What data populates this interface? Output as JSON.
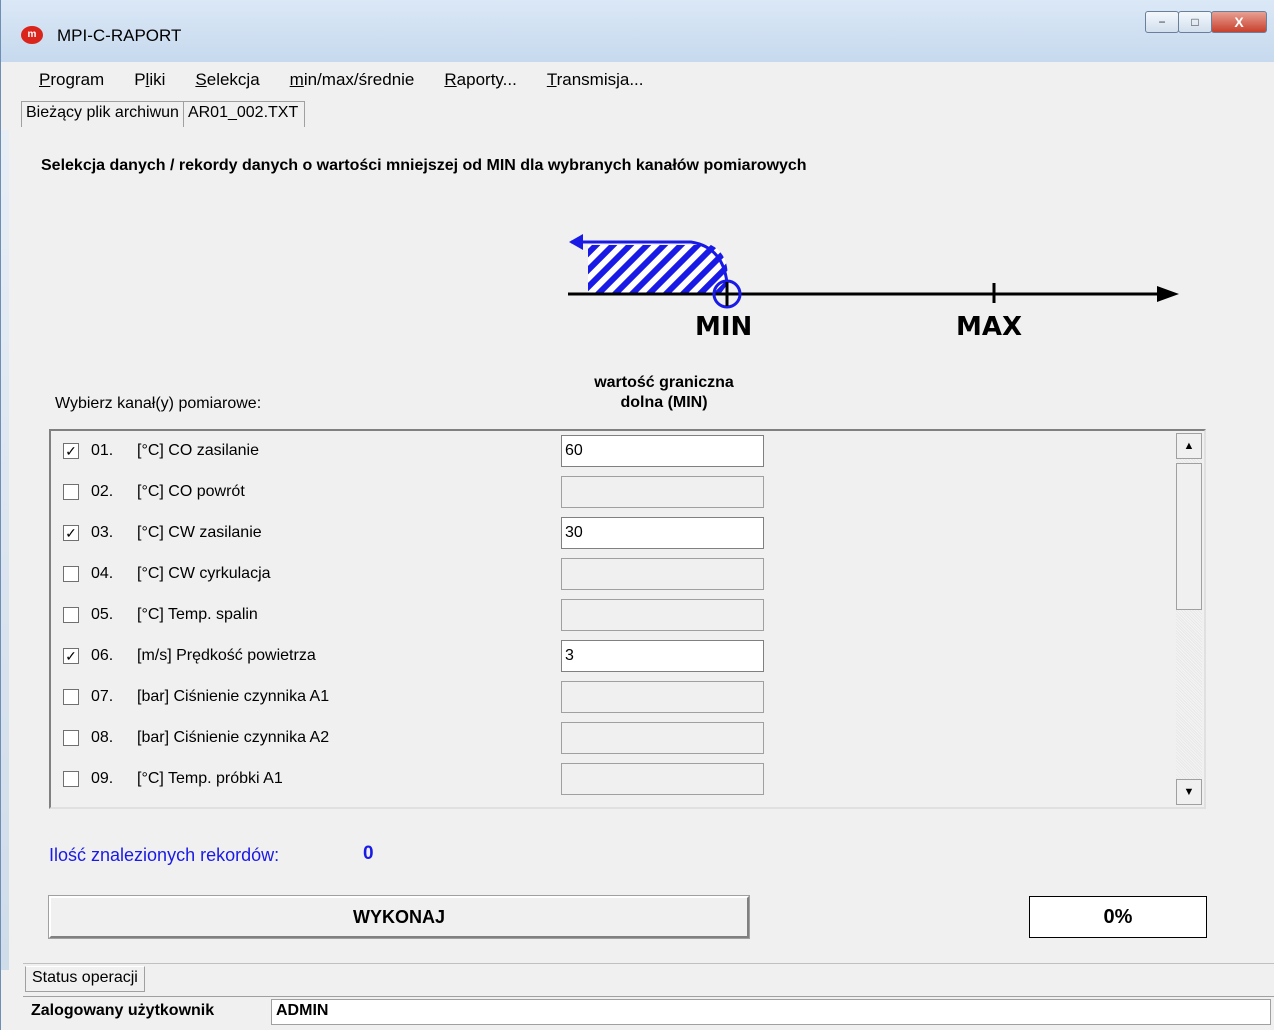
{
  "window": {
    "title": "MPI-C-RAPORT",
    "logo": "m",
    "minimize": "−",
    "maximize": "□",
    "close": "X"
  },
  "menu": [
    {
      "pre": "",
      "u": "P",
      "post": "rogram"
    },
    {
      "pre": "P",
      "u": "l",
      "post": "iki"
    },
    {
      "pre": "",
      "u": "S",
      "post": "elekcja"
    },
    {
      "pre": "",
      "u": "m",
      "post": "in/max/średnie"
    },
    {
      "pre": "",
      "u": "R",
      "post": "aporty..."
    },
    {
      "pre": "",
      "u": "T",
      "post": "ransmisja..."
    }
  ],
  "file": {
    "label": "Bieżący plik archiwun",
    "value": "AR01_002.TXT"
  },
  "header": "Selekcja danych / rekordy danych o wartości mniejszej od MIN dla wybranych kanałów pomiarowych",
  "diagram": {
    "min": "MIN",
    "max": "MAX"
  },
  "channel_label": "Wybierz kanał(y) pomiarowe:",
  "column_header_line1": "wartość graniczna",
  "column_header_line2": "dolna (MIN)",
  "rows": [
    {
      "num": "01.",
      "name": "[°C] CO zasilanie",
      "checked": true,
      "value": "60"
    },
    {
      "num": "02.",
      "name": "[°C] CO powrót",
      "checked": false,
      "value": ""
    },
    {
      "num": "03.",
      "name": "[°C] CW zasilanie",
      "checked": true,
      "value": "30"
    },
    {
      "num": "04.",
      "name": "[°C] CW cyrkulacja",
      "checked": false,
      "value": ""
    },
    {
      "num": "05.",
      "name": "[°C] Temp. spalin",
      "checked": false,
      "value": ""
    },
    {
      "num": "06.",
      "name": "[m/s] Prędkość powietrza",
      "checked": true,
      "value": "3"
    },
    {
      "num": "07.",
      "name": "[bar] Ciśnienie czynnika A1",
      "checked": false,
      "value": ""
    },
    {
      "num": "08.",
      "name": "[bar] Ciśnienie czynnika A2",
      "checked": false,
      "value": ""
    },
    {
      "num": "09.",
      "name": "[°C] Temp. próbki A1",
      "checked": false,
      "value": ""
    }
  ],
  "found": {
    "label": "Ilość znalezionych rekordów:",
    "value": "0"
  },
  "execute_label": "WYKONAJ",
  "progress": "0%",
  "status": {
    "label": "Status operacji"
  },
  "user": {
    "label": "Zalogowany użytkownik",
    "value": "ADMIN"
  }
}
